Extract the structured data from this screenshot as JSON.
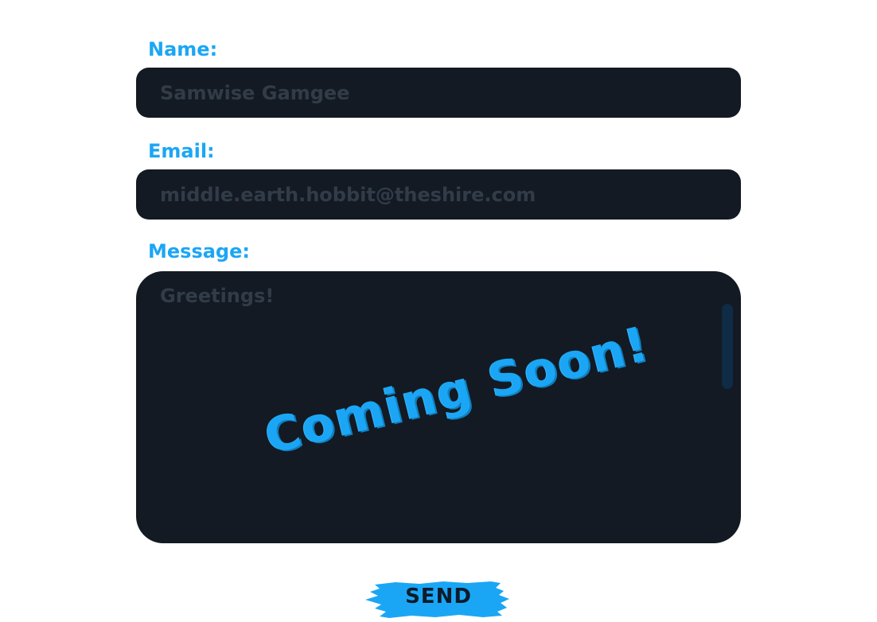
{
  "form": {
    "name_label": "Name:",
    "name_placeholder": "Samwise Gamgee",
    "email_label": "Email:",
    "email_placeholder": "middle.earth.hobbit@theshire.com",
    "message_label": "Message:",
    "message_placeholder": "Greetings!",
    "overlay_text": "Coming Soon!",
    "send_label": "SEND"
  },
  "colors": {
    "accent": "#1ba6f5",
    "field_background": "#131a23",
    "placeholder": "#323c48",
    "scrollbar": "#0f2b46",
    "button_text": "#0d1b2a"
  }
}
